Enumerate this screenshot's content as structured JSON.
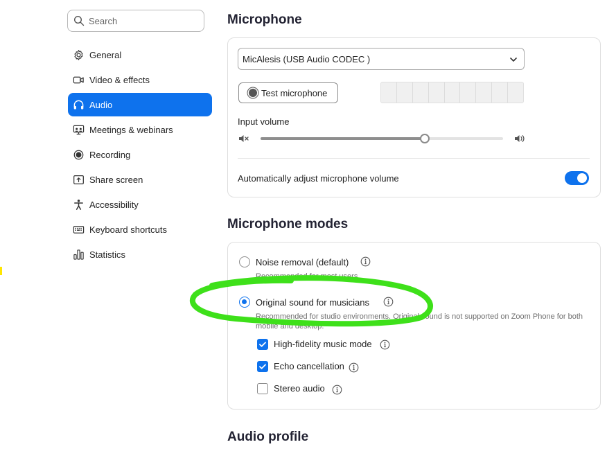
{
  "sidebar": {
    "search_placeholder": "Search",
    "items": [
      {
        "label": "General",
        "icon": "gear-icon",
        "active": false
      },
      {
        "label": "Video & effects",
        "icon": "video-camera-icon",
        "active": false
      },
      {
        "label": "Audio",
        "icon": "headphones-icon",
        "active": true
      },
      {
        "label": "Meetings & webinars",
        "icon": "meetings-icon",
        "active": false
      },
      {
        "label": "Recording",
        "icon": "record-icon",
        "active": false
      },
      {
        "label": "Share screen",
        "icon": "share-screen-icon",
        "active": false
      },
      {
        "label": "Accessibility",
        "icon": "accessibility-icon",
        "active": false
      },
      {
        "label": "Keyboard shortcuts",
        "icon": "keyboard-icon",
        "active": false
      },
      {
        "label": "Statistics",
        "icon": "statistics-icon",
        "active": false
      }
    ]
  },
  "microphone": {
    "title": "Microphone",
    "device": "MicAlesis  (USB Audio CODEC )",
    "test_button": "Test microphone",
    "input_volume_label": "Input volume",
    "input_volume": 0.676,
    "auto_adjust_label": "Automatically adjust microphone volume",
    "auto_adjust_on": true
  },
  "modes": {
    "title": "Microphone modes",
    "noise_removal": {
      "label": "Noise removal (default)",
      "desc": "Recommended for most users.",
      "selected": false
    },
    "original_sound": {
      "label": "Original sound for musicians",
      "desc": "Recommended for studio environments. Original sound is not supported on Zoom Phone for both mobile and desktop.",
      "selected": true
    },
    "options": [
      {
        "label": "High-fidelity music mode",
        "checked": true
      },
      {
        "label": "Echo cancellation",
        "checked": true
      },
      {
        "label": "Stereo audio",
        "checked": false
      }
    ]
  },
  "audio_profile": {
    "title": "Audio profile"
  },
  "colors": {
    "accent": "#0e72ed",
    "annotation": "#3ee01a"
  }
}
